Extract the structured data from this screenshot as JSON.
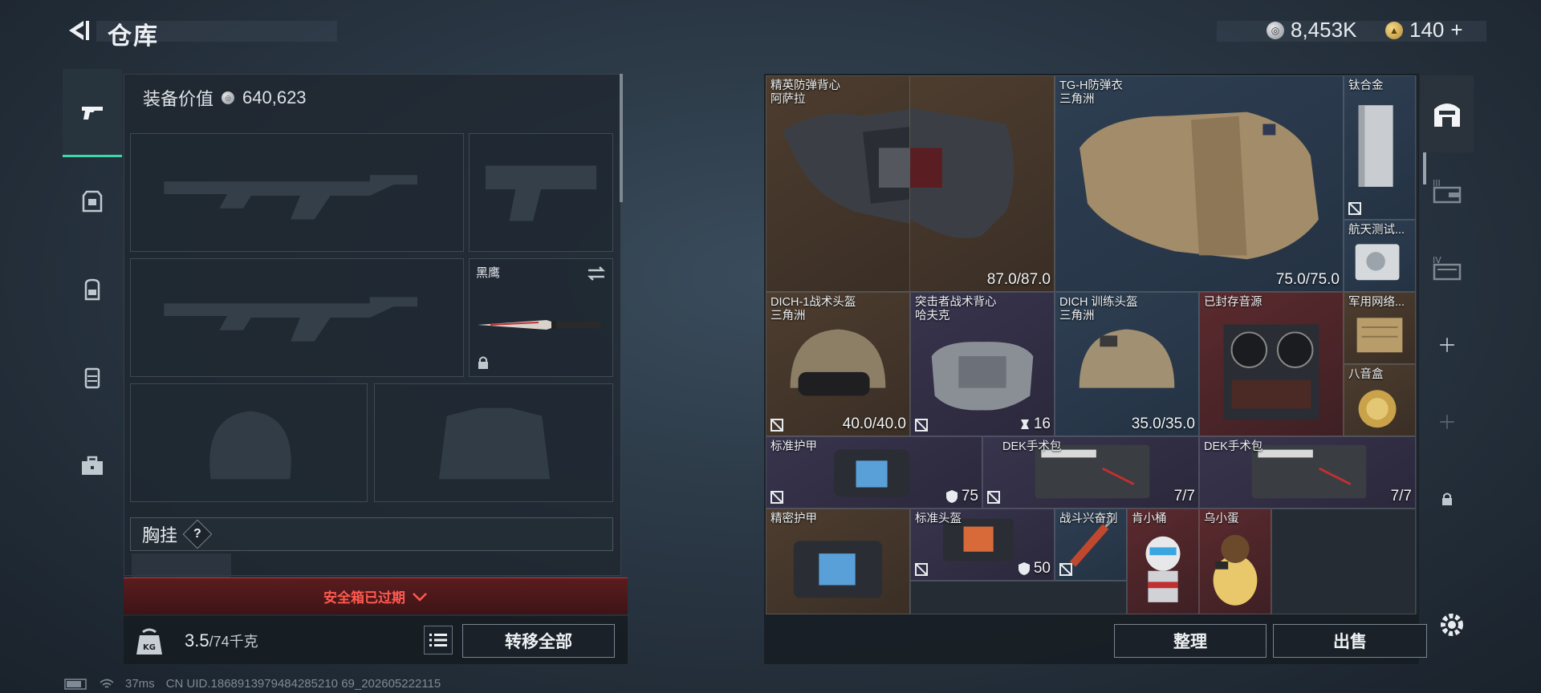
{
  "header": {
    "title": "仓库"
  },
  "currency": {
    "silver": "8,453K",
    "gold": "140",
    "gold_plus": "+"
  },
  "left_panel": {
    "equip_value_label": "装备价值",
    "equip_value": "640,623",
    "knife_name": "黑鹰",
    "chest_rig_label": "胸挂",
    "chest_rig_help": "?",
    "safe_box_status": "安全箱已过期",
    "weight_current": "3.5",
    "weight_max": "/74千克",
    "transfer_all": "转移全部"
  },
  "grid": {
    "items": [
      {
        "name": "精英防弹背心",
        "sub": "阿萨拉",
        "value": "87.0/87.0"
      },
      {
        "name": "TG-H防弹衣",
        "sub": "三角洲",
        "value": "75.0/75.0"
      },
      {
        "name": "钛合金",
        "sub": "",
        "value": ""
      },
      {
        "name": "航天测试...",
        "sub": "",
        "value": ""
      },
      {
        "name": "DICH-1战术头盔",
        "sub": "三角洲",
        "value": "40.0/40.0"
      },
      {
        "name": "突击者战术背心",
        "sub": "哈夫克",
        "value": "16"
      },
      {
        "name": "DICH 训练头盔",
        "sub": "三角洲",
        "value": "35.0/35.0"
      },
      {
        "name": "已封存音源",
        "sub": "",
        "value": ""
      },
      {
        "name": "军用网络...",
        "sub": "",
        "value": ""
      },
      {
        "name": "八音盒",
        "sub": "",
        "value": ""
      },
      {
        "name": "标准护甲",
        "sub": "",
        "value": "75"
      },
      {
        "name": "DEK手术包",
        "sub": "",
        "value": "7/7"
      },
      {
        "name": "DEK手术包",
        "sub": "",
        "value": "7/7"
      },
      {
        "name": "精密护甲",
        "sub": "",
        "value": ""
      },
      {
        "name": "标准头盔",
        "sub": "",
        "value": "50"
      },
      {
        "name": "战斗兴奋剂",
        "sub": "",
        "value": ""
      },
      {
        "name": "肯小桶",
        "sub": "",
        "value": ""
      },
      {
        "name": "乌小蛋",
        "sub": "",
        "value": ""
      }
    ],
    "sort_label": "整理",
    "sell_label": "出售"
  },
  "right_nav": {
    "tab4_label": "IV"
  },
  "status_bar": {
    "ping": "37ms",
    "uid": "CN UID.1868913979484285210 69_202605222115"
  }
}
